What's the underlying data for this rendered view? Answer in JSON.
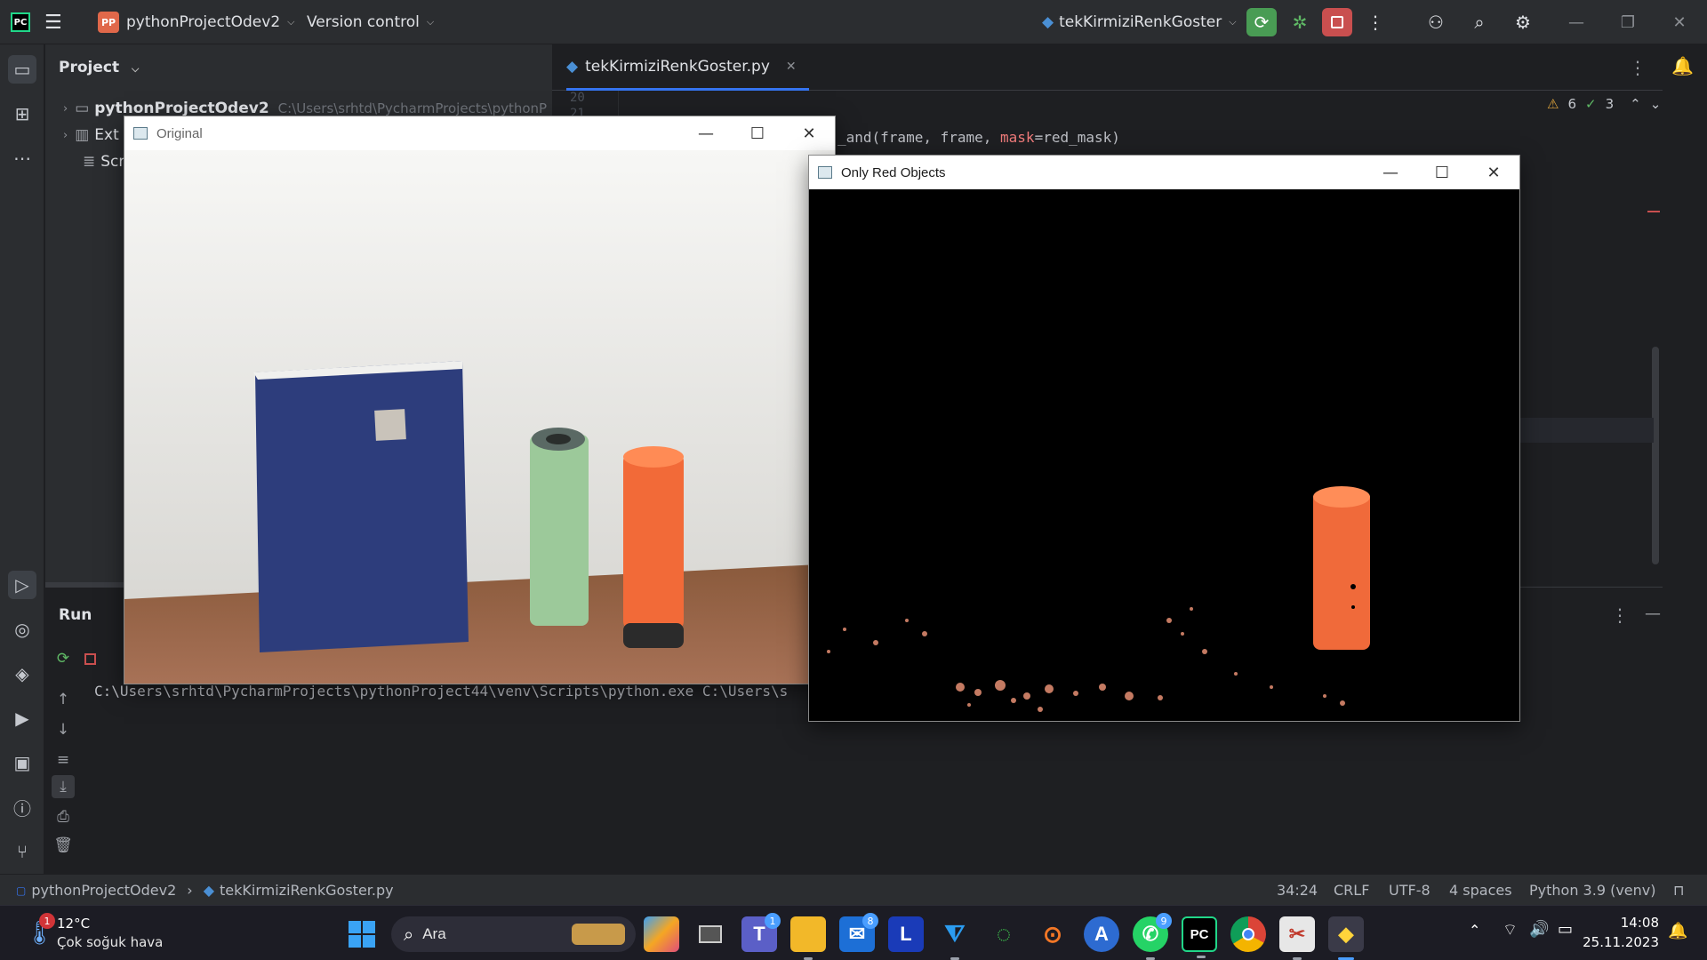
{
  "titlebar": {
    "project_badge": "PP",
    "project_name": "pythonProjectOdev2",
    "vcs_label": "Version control",
    "run_config": "tekKirmiziRenkGoster"
  },
  "project_panel": {
    "title": "Project",
    "root_name": "pythonProjectOdev2",
    "root_path": "C:\\Users\\srhtd\\PycharmProjects\\pythonP",
    "ext_label": "Ext",
    "scr_label": "Scr"
  },
  "editor": {
    "tab_name": "tekKirmiziRenkGoster.py",
    "line_numbers": [
      "20",
      "21"
    ],
    "code_visible": {
      "prefix": "_and(frame, frame, ",
      "param": "mask",
      "suffix": "=red_mask)"
    },
    "warnings_count": "6",
    "checks_count": "3"
  },
  "run_panel": {
    "title": "Run",
    "console_line": "C:\\Users\\srhtd\\PycharmProjects\\pythonProject44\\venv\\Scripts\\python.exe C:\\Users\\s"
  },
  "statusbar": {
    "breadcrumb_project": "pythonProjectOdev2",
    "breadcrumb_file": "tekKirmiziRenkGoster.py",
    "position": "34:24",
    "line_sep": "CRLF",
    "encoding": "UTF-8",
    "indent": "4 spaces",
    "interpreter": "Python 3.9 (venv)"
  },
  "windows": {
    "original_title": "Original",
    "red_title": "Only Red Objects"
  },
  "taskbar": {
    "weather_temp": "12°C",
    "weather_desc": "Çok soğuk hava",
    "weather_badge": "1",
    "search_label": "Ara",
    "teams_badge": "1",
    "mail_badge": "8",
    "whatsapp_badge": "9",
    "time": "14:08",
    "date": "25.11.2023",
    "icons": [
      "windows-start",
      "copilot",
      "task-view",
      "teams",
      "file-explorer",
      "mail",
      "l-app",
      "vscode",
      "circle-app",
      "jupyter",
      "arc-app",
      "whatsapp",
      "pycharm",
      "chrome",
      "snipping-tool",
      "python"
    ]
  },
  "colors": {
    "accent": "#3574f0",
    "stop_red": "#c94f4f",
    "run_green": "#499c54",
    "ide_bg": "#1e1f22",
    "panel_bg": "#2b2d30"
  }
}
